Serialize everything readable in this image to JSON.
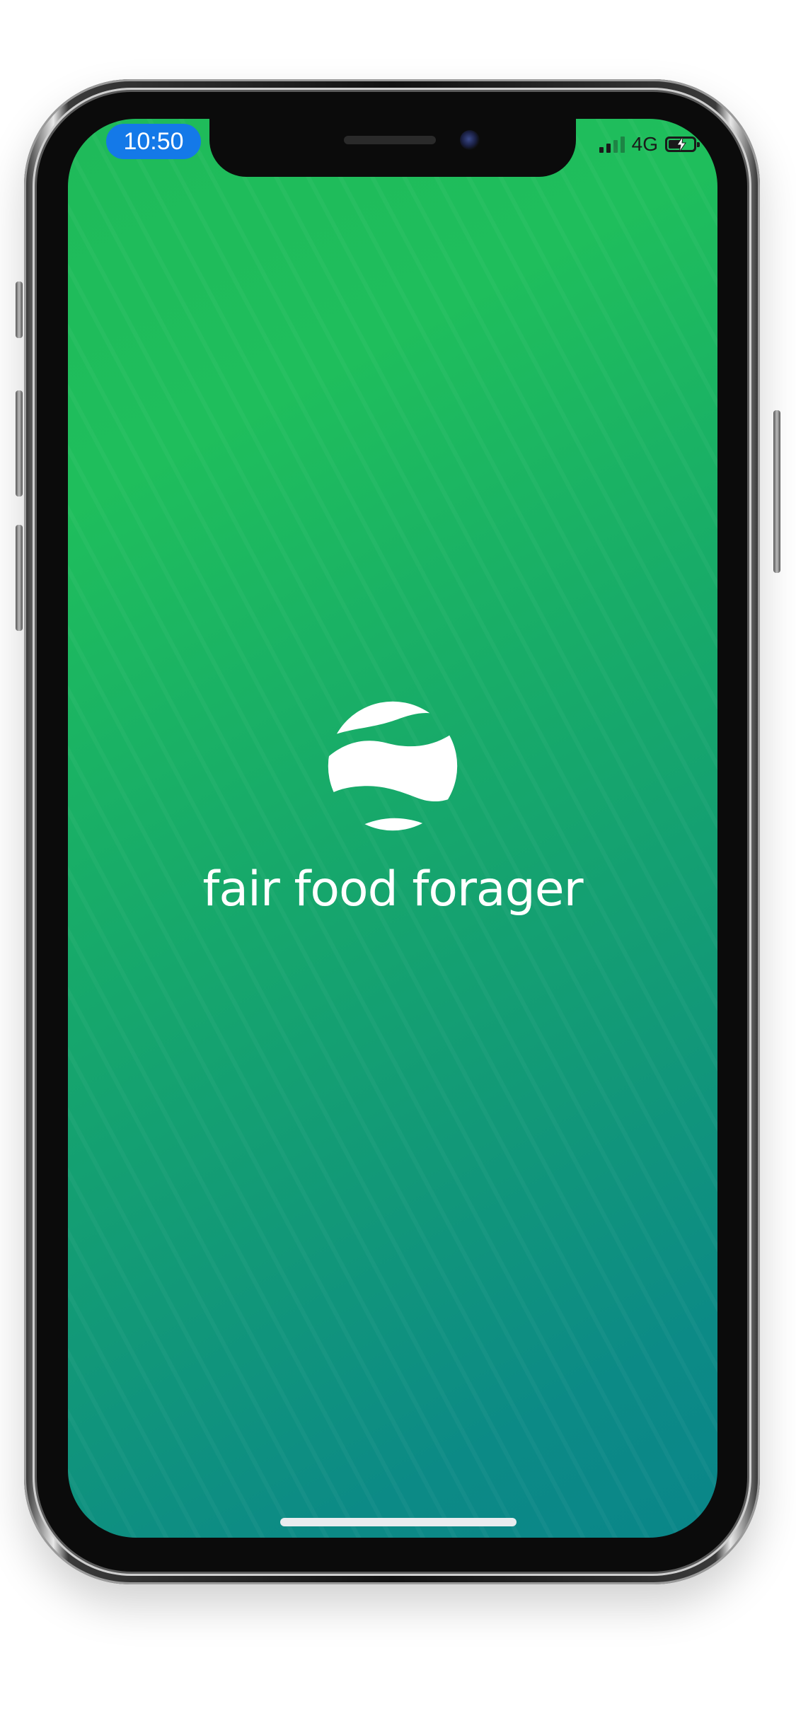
{
  "status_bar": {
    "time": "10:50",
    "network": "4G",
    "signal_bars_active": 2,
    "signal_bars_total": 4,
    "battery_charging": true,
    "battery_level": 0.55,
    "time_pill_color": "#1479e8"
  },
  "splash": {
    "logo_icon": "wave-globe-icon",
    "brand_name": "fair food forager"
  },
  "colors": {
    "gradient_start": "#1fbe5c",
    "gradient_end": "#0a8689",
    "text": "#ffffff"
  }
}
